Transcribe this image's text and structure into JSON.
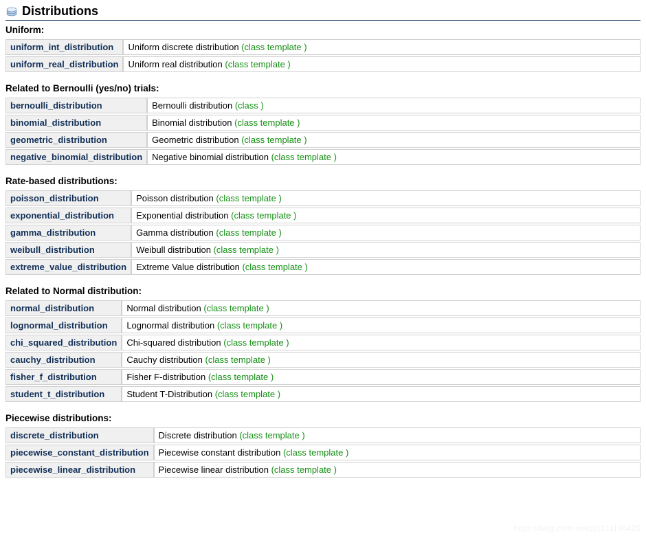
{
  "title": "Distributions",
  "watermark": "https://blog.csdn.net/zj1131190425",
  "sections": [
    {
      "heading": "Uniform:",
      "items": [
        {
          "name": "uniform_int_distribution",
          "desc": "Uniform discrete distribution",
          "type": "(class template )"
        },
        {
          "name": "uniform_real_distribution",
          "desc": "Uniform real distribution",
          "type": "(class template )"
        }
      ]
    },
    {
      "heading": "Related to Bernoulli (yes/no) trials:",
      "items": [
        {
          "name": "bernoulli_distribution",
          "desc": "Bernoulli distribution",
          "type": "(class )"
        },
        {
          "name": "binomial_distribution",
          "desc": "Binomial distribution",
          "type": "(class template )"
        },
        {
          "name": "geometric_distribution",
          "desc": "Geometric distribution",
          "type": "(class template )"
        },
        {
          "name": "negative_binomial_distribution",
          "desc": "Negative binomial distribution",
          "type": "(class template )"
        }
      ]
    },
    {
      "heading": "Rate-based distributions:",
      "items": [
        {
          "name": "poisson_distribution",
          "desc": "Poisson distribution",
          "type": "(class template )"
        },
        {
          "name": "exponential_distribution",
          "desc": "Exponential distribution",
          "type": "(class template )"
        },
        {
          "name": "gamma_distribution",
          "desc": "Gamma distribution",
          "type": "(class template )"
        },
        {
          "name": "weibull_distribution",
          "desc": "Weibull distribution",
          "type": "(class template )"
        },
        {
          "name": "extreme_value_distribution",
          "desc": "Extreme Value distribution",
          "type": "(class template )"
        }
      ]
    },
    {
      "heading": "Related to Normal distribution:",
      "items": [
        {
          "name": "normal_distribution",
          "desc": "Normal distribution",
          "type": "(class template )"
        },
        {
          "name": "lognormal_distribution",
          "desc": "Lognormal distribution",
          "type": "(class template )"
        },
        {
          "name": "chi_squared_distribution",
          "desc": "Chi-squared distribution",
          "type": "(class template )"
        },
        {
          "name": "cauchy_distribution",
          "desc": "Cauchy distribution",
          "type": "(class template )"
        },
        {
          "name": "fisher_f_distribution",
          "desc": "Fisher F-distribution",
          "type": "(class template )"
        },
        {
          "name": "student_t_distribution",
          "desc": "Student T-Distribution",
          "type": "(class template )"
        }
      ]
    },
    {
      "heading": "Piecewise distributions:",
      "items": [
        {
          "name": "discrete_distribution",
          "desc": "Discrete distribution",
          "type": "(class template )"
        },
        {
          "name": "piecewise_constant_distribution",
          "desc": "Piecewise constant distribution",
          "type": "(class template )"
        },
        {
          "name": "piecewise_linear_distribution",
          "desc": "Piecewise linear distribution",
          "type": "(class template )"
        }
      ]
    }
  ]
}
